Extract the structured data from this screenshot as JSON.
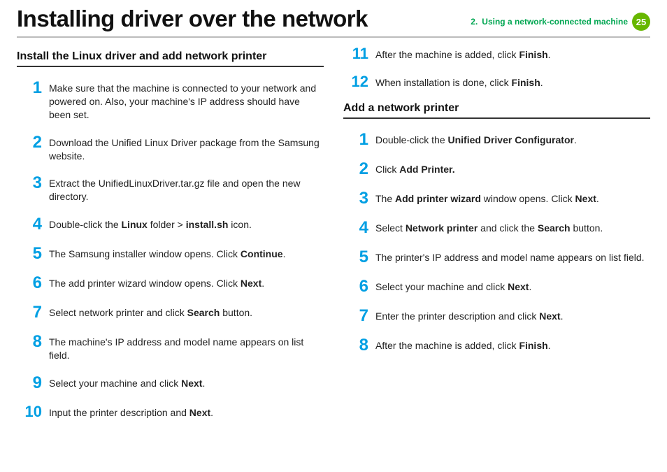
{
  "header": {
    "title": "Installing driver over the network",
    "crumb_prefix": "2.",
    "crumb_label": "Using a network-connected machine",
    "page_number": "25"
  },
  "left": {
    "section_title": "Install the Linux driver and add network printer",
    "steps": [
      {
        "n": "1",
        "segments": [
          {
            "t": "Make sure that the machine is connected to your network and powered on. Also, your machine's IP address should have been set."
          }
        ]
      },
      {
        "n": "2",
        "segments": [
          {
            "t": "Download the Unified Linux Driver package from the Samsung website."
          }
        ]
      },
      {
        "n": "3",
        "segments": [
          {
            "t": "Extract the UnifiedLinuxDriver.tar.gz file and open the new directory."
          }
        ]
      },
      {
        "n": "4",
        "segments": [
          {
            "t": "Double-click the "
          },
          {
            "t": "Linux",
            "b": true
          },
          {
            "t": " folder > "
          },
          {
            "t": "install.sh",
            "b": true
          },
          {
            "t": " icon."
          }
        ]
      },
      {
        "n": "5",
        "segments": [
          {
            "t": "The Samsung installer window opens. Click "
          },
          {
            "t": "Continue",
            "b": true
          },
          {
            "t": "."
          }
        ]
      },
      {
        "n": "6",
        "segments": [
          {
            "t": "The add printer wizard window opens. Click "
          },
          {
            "t": "Next",
            "b": true
          },
          {
            "t": "."
          }
        ]
      },
      {
        "n": "7",
        "segments": [
          {
            "t": "Select network printer and click "
          },
          {
            "t": "Search",
            "b": true
          },
          {
            "t": " button."
          }
        ]
      },
      {
        "n": "8",
        "segments": [
          {
            "t": "The machine's IP address and model name appears on list field."
          }
        ]
      },
      {
        "n": "9",
        "segments": [
          {
            "t": "Select your machine and click "
          },
          {
            "t": "Next",
            "b": true
          },
          {
            "t": "."
          }
        ]
      },
      {
        "n": "10",
        "segments": [
          {
            "t": "Input the printer description and "
          },
          {
            "t": "Next",
            "b": true
          },
          {
            "t": "."
          }
        ]
      }
    ]
  },
  "right_top": {
    "steps": [
      {
        "n": "11",
        "segments": [
          {
            "t": "After the machine is added, click "
          },
          {
            "t": "Finish",
            "b": true
          },
          {
            "t": "."
          }
        ]
      },
      {
        "n": "12",
        "segments": [
          {
            "t": "When installation is done, click "
          },
          {
            "t": "Finish",
            "b": true
          },
          {
            "t": "."
          }
        ]
      }
    ]
  },
  "right": {
    "section_title": "Add a network printer",
    "steps": [
      {
        "n": "1",
        "segments": [
          {
            "t": "Double-click the "
          },
          {
            "t": "Unified Driver Configurator",
            "b": true
          },
          {
            "t": "."
          }
        ]
      },
      {
        "n": "2",
        "segments": [
          {
            "t": "Click "
          },
          {
            "t": "Add Printer.",
            "b": true
          }
        ]
      },
      {
        "n": "3",
        "segments": [
          {
            "t": "The "
          },
          {
            "t": "Add printer wizard",
            "b": true
          },
          {
            "t": " window opens. Click "
          },
          {
            "t": "Next",
            "b": true
          },
          {
            "t": "."
          }
        ]
      },
      {
        "n": "4",
        "segments": [
          {
            "t": "Select "
          },
          {
            "t": "Network printer",
            "b": true
          },
          {
            "t": " and click the "
          },
          {
            "t": "Search",
            "b": true
          },
          {
            "t": " button."
          }
        ]
      },
      {
        "n": "5",
        "segments": [
          {
            "t": "The printer's IP address and model name appears on list field."
          }
        ]
      },
      {
        "n": "6",
        "segments": [
          {
            "t": "Select your machine and click "
          },
          {
            "t": "Next",
            "b": true
          },
          {
            "t": "."
          }
        ]
      },
      {
        "n": "7",
        "segments": [
          {
            "t": "Enter the printer description and click "
          },
          {
            "t": "Next",
            "b": true
          },
          {
            "t": "."
          }
        ]
      },
      {
        "n": "8",
        "segments": [
          {
            "t": "After the machine is added, click "
          },
          {
            "t": "Finish",
            "b": true
          },
          {
            "t": "."
          }
        ]
      }
    ]
  }
}
